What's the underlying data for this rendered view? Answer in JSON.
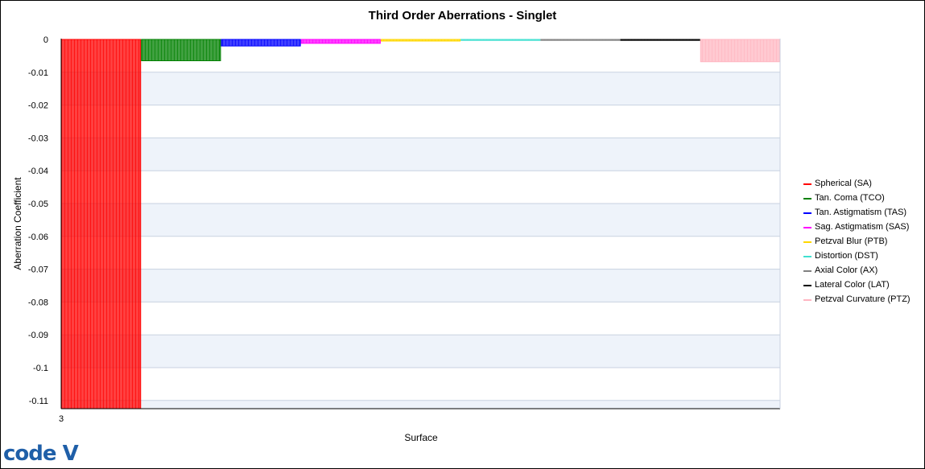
{
  "chart_data": {
    "type": "bar",
    "title": "Third Order Aberrations - Singlet",
    "xlabel": "Surface",
    "ylabel": "Aberration Coefficient",
    "categories": [
      "3"
    ],
    "ylim": [
      -0.1125,
      0
    ],
    "yticks": [
      "0",
      "-0.01",
      "-0.02",
      "-0.03",
      "-0.04",
      "-0.05",
      "-0.06",
      "-0.07",
      "-0.08",
      "-0.09",
      "-0.1",
      "-0.11"
    ],
    "grid": "alternating horizontal bands",
    "legend_position": "right",
    "series": [
      {
        "name": "Spherical (SA)",
        "color": "#ff0000",
        "value": -0.1125
      },
      {
        "name": "Tan. Coma (TCO)",
        "color": "#008000",
        "value": -0.0065
      },
      {
        "name": "Tan. Astigmatism (TAS)",
        "color": "#0000ff",
        "value": -0.002
      },
      {
        "name": "Sag. Astigmatism (SAS)",
        "color": "#ff00ff",
        "value": -0.0012
      },
      {
        "name": "Petzval Blur (PTB)",
        "color": "#ffd700",
        "value": -0.0005
      },
      {
        "name": "Distortion (DST)",
        "color": "#40e0d0",
        "value": -0.0003
      },
      {
        "name": "Axial Color (AX)",
        "color": "#808080",
        "value": -0.0002
      },
      {
        "name": "Lateral Color (LAT)",
        "color": "#000000",
        "value": -0.0001
      },
      {
        "name": "Petzval Curvature (PTZ)",
        "color": "#ffb6c1",
        "value": -0.0068
      }
    ]
  },
  "logo": {
    "text": "code V"
  }
}
